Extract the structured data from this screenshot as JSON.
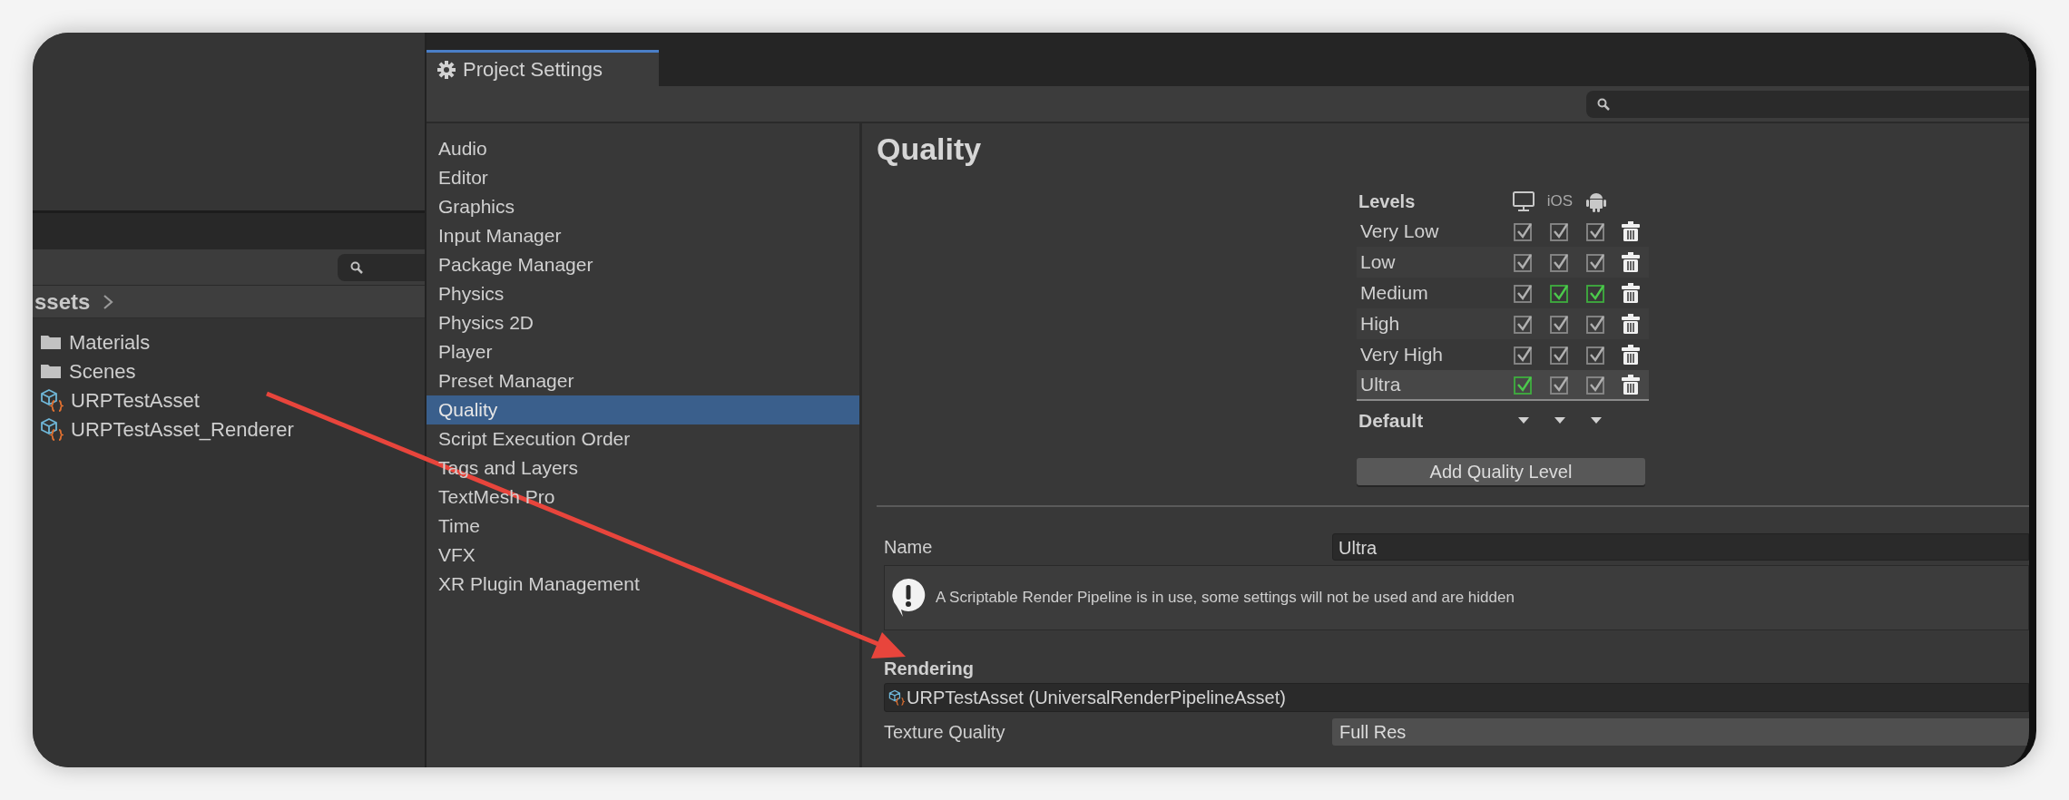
{
  "project_panel": {
    "breadcrumb": "ssets",
    "items": [
      {
        "kind": "folder",
        "label": "Materials"
      },
      {
        "kind": "folder",
        "label": "Scenes"
      },
      {
        "kind": "asset",
        "label": "URPTestAsset"
      },
      {
        "kind": "asset",
        "label": "URPTestAsset_Renderer"
      }
    ]
  },
  "settings_window": {
    "tab": "Project Settings",
    "sidebar": [
      {
        "label": "Audio",
        "selected": false
      },
      {
        "label": "Editor",
        "selected": false
      },
      {
        "label": "Graphics",
        "selected": false
      },
      {
        "label": "Input Manager",
        "selected": false
      },
      {
        "label": "Package Manager",
        "selected": false
      },
      {
        "label": "Physics",
        "selected": false
      },
      {
        "label": "Physics 2D",
        "selected": false
      },
      {
        "label": "Player",
        "selected": false
      },
      {
        "label": "Preset Manager",
        "selected": false
      },
      {
        "label": "Quality",
        "selected": true
      },
      {
        "label": "Script Execution Order",
        "selected": false
      },
      {
        "label": "Tags and Layers",
        "selected": false
      },
      {
        "label": "TextMesh Pro",
        "selected": false
      },
      {
        "label": "Time",
        "selected": false
      },
      {
        "label": "VFX",
        "selected": false
      },
      {
        "label": "XR Plugin Management",
        "selected": false
      }
    ]
  },
  "quality": {
    "title": "Quality",
    "levels_header": "Levels",
    "platforms": [
      {
        "kind": "desktop"
      },
      {
        "kind": "text",
        "label": "iOS"
      },
      {
        "kind": "android"
      }
    ],
    "levels": [
      {
        "name": "Very Low",
        "selected": false,
        "platforms": [
          {
            "checked": true,
            "default": false
          },
          {
            "checked": true,
            "default": false
          },
          {
            "checked": true,
            "default": false
          }
        ]
      },
      {
        "name": "Low",
        "selected": false,
        "platforms": [
          {
            "checked": true,
            "default": false
          },
          {
            "checked": true,
            "default": false
          },
          {
            "checked": true,
            "default": false
          }
        ]
      },
      {
        "name": "Medium",
        "selected": false,
        "platforms": [
          {
            "checked": true,
            "default": false
          },
          {
            "checked": true,
            "default": true
          },
          {
            "checked": true,
            "default": true
          }
        ]
      },
      {
        "name": "High",
        "selected": false,
        "platforms": [
          {
            "checked": true,
            "default": false
          },
          {
            "checked": true,
            "default": false
          },
          {
            "checked": true,
            "default": false
          }
        ]
      },
      {
        "name": "Very High",
        "selected": false,
        "platforms": [
          {
            "checked": true,
            "default": false
          },
          {
            "checked": true,
            "default": false
          },
          {
            "checked": true,
            "default": false
          }
        ]
      },
      {
        "name": "Ultra",
        "selected": true,
        "platforms": [
          {
            "checked": true,
            "default": true
          },
          {
            "checked": true,
            "default": false
          },
          {
            "checked": true,
            "default": false
          }
        ]
      }
    ],
    "default_label": "Default",
    "add_button": "Add Quality Level",
    "name_label": "Name",
    "name_value": "Ultra",
    "help_message": "A Scriptable Render Pipeline is in use, some settings will not be used and are hidden",
    "rendering_label": "Rendering",
    "pipeline_asset": "URPTestAsset (UniversalRenderPipelineAsset)",
    "texture_quality_label": "Texture Quality",
    "texture_quality_value": "Full Res"
  }
}
